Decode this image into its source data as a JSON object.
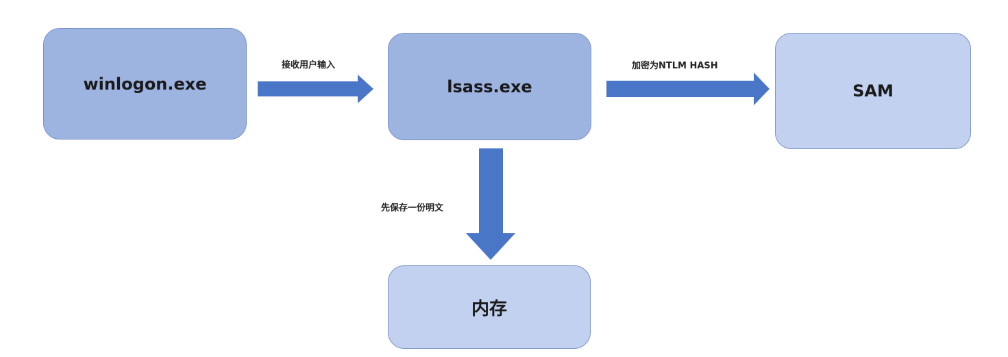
{
  "colors": {
    "box_dark": "#9db3e0",
    "box_light": "#c2d1ef",
    "box_border": "#7a93c9",
    "arrow": "#4a76c8"
  },
  "nodes": {
    "winlogon": "winlogon.exe",
    "lsass": "lsass.exe",
    "sam": "SAM",
    "memory": "内存"
  },
  "edges": {
    "winlogon_to_lsass": "接收用户输入",
    "lsass_to_sam": "加密为NTLM HASH",
    "lsass_to_memory": "先保存一份明文"
  }
}
